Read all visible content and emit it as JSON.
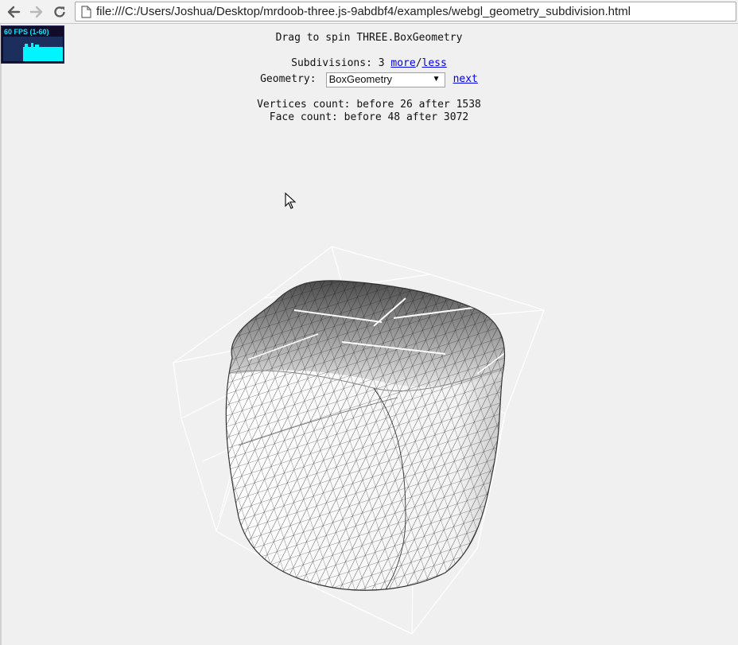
{
  "browser": {
    "url": "file:///C:/Users/Joshua/Desktop/mrdoob-three.js-9abdbf4/examples/webgl_geometry_subdivision.html"
  },
  "stats": {
    "label": "60 FPS (1-60)"
  },
  "info": {
    "drag_text": "Drag to spin THREE.BoxGeometry",
    "subdivisions_label": "Subdivisions: 3",
    "more_link": "more",
    "separator": "/",
    "less_link": "less",
    "geometry_label": "Geometry:",
    "geometry_selected": "BoxGeometry",
    "next_link": "next",
    "vertices_text": "Vertices count: before 26 after 1538",
    "faces_text": "Face count: before 48 after 3072"
  },
  "colors": {
    "background": "#f0f0f0",
    "stats_text": "#00e8ff",
    "link": "#0000ee"
  }
}
